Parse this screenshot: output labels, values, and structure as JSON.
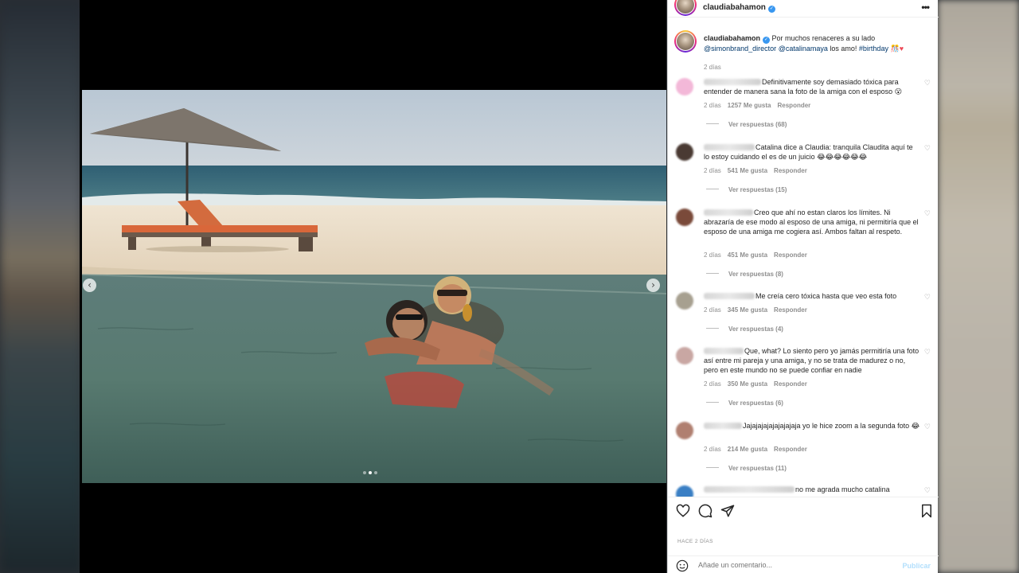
{
  "post": {
    "username": "claudiabahamon",
    "verified_mark": "✓",
    "more_icon": "•••",
    "caption": {
      "username": "claudiabahamon",
      "text": "Por muchos renaceres a su lado",
      "mention1": "@simonbrand_director",
      "mention2": "@catalinamaya",
      "text2": "los amo!",
      "hashtag": "#birthday",
      "emojis": "🎊",
      "heart": "♥",
      "time": "2 días"
    },
    "carousel": {
      "prev": "‹",
      "next": "›",
      "slides": 3,
      "active_slide": 2
    }
  },
  "comments": [
    {
      "text": "Definitivamente soy demasiado tóxica para entender de manera sana la foto de la amiga con el esposo 😮",
      "time": "2 días",
      "likes": "1257 Me gusta",
      "reply": "Responder",
      "replies": "Ver respuestas (68)",
      "avatar_color": "#f3b8d8"
    },
    {
      "text": "Catalina dice a Claudia: tranquila Claudita aquí te lo estoy cuidando el es de un juicio 😂😂😂😂😂😂",
      "time": "2 días",
      "likes": "541 Me gusta",
      "reply": "Responder",
      "replies": "Ver respuestas (15)",
      "avatar_color": "#4a3a33"
    },
    {
      "text": "Creo que ahí no estan claros los límites. Ni abrazaría de ese modo al esposo de una amiga, ni permitiría que el esposo de una amiga me cogiera así. Ambos faltan al respeto.",
      "time": "2 días",
      "likes": "451 Me gusta",
      "reply": "Responder",
      "replies": "Ver respuestas (8)",
      "avatar_color": "#7a4a3a"
    },
    {
      "text": "Me creía cero tóxica hasta que veo esta foto",
      "time": "2 días",
      "likes": "345 Me gusta",
      "reply": "Responder",
      "replies": "Ver respuestas (4)",
      "avatar_color": "#a7a090"
    },
    {
      "text": "Que, what? Lo siento pero yo jamás permitiría una foto así entre mi pareja y una amiga, y no se trata de madurez o no, pero en este mundo no se puede confiar en nadie",
      "time": "2 días",
      "likes": "350 Me gusta",
      "reply": "Responder",
      "replies": "Ver respuestas (6)",
      "avatar_color": "#c9a7a3"
    },
    {
      "text": "Jajajajajajajajajaja yo le hice zoom a la segunda foto 😂",
      "time": "2 días",
      "likes": "214 Me gusta",
      "reply": "Responder",
      "replies": "Ver respuestas (11)",
      "avatar_color": "#b07f70"
    },
    {
      "text": "no me agrada mucho catalina",
      "avatar_color": "#3a7fc4"
    }
  ],
  "likes_row": "",
  "ago": "HACE 2 DÍAS",
  "comment_input": {
    "placeholder": "Añade un comentario...",
    "publish": "Publicar"
  }
}
